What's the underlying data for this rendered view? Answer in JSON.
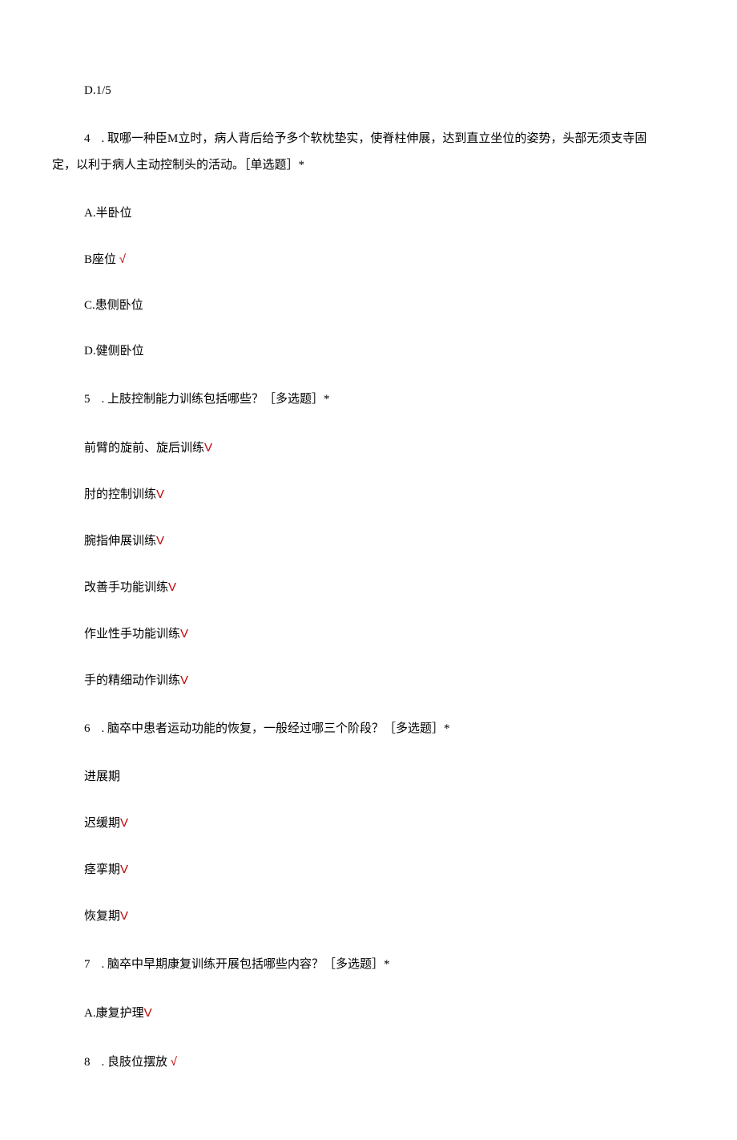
{
  "q3_option_d": "D.1/5",
  "q4": {
    "num": "4",
    "text_line1": ". 取哪一种臣M立时，病人背后给予多个软枕垫实，使脊柱伸展，达到直立坐位的姿势，头部无须支寺固",
    "text_line2": "定，以利于病人主动控制头的活动。［单选题］*",
    "options": {
      "a": "A.半卧位",
      "b": "B座位",
      "c": "C.患侧卧位",
      "d": "D.健侧卧位"
    }
  },
  "q5": {
    "num": "5",
    "text": ". 上肢控制能力训练包括哪些？［多选题］*",
    "options": {
      "a": "前臂的旋前、旋后训练",
      "b": "肘的控制训练",
      "c": "腕指伸展训练",
      "d": "改善手功能训练",
      "e": "作业性手功能训练",
      "f": "手的精细动作训练"
    }
  },
  "q6": {
    "num": "6",
    "text": ". 脑卒中患者运动功能的恢复，一般经过哪三个阶段？［多选题］*",
    "options": {
      "a": "进展期",
      "b": "迟缓期",
      "c": "痉挛期",
      "d": "恢复期"
    }
  },
  "q7": {
    "num": "7",
    "text": ". 脑卒中早期康复训练开展包括哪些内容？［多选题］*",
    "options": {
      "a": "A.康复护理"
    }
  },
  "q8": {
    "num": "8",
    "text": ". 良肢位摆放"
  },
  "marks": {
    "check": "√",
    "checkV": "V"
  }
}
